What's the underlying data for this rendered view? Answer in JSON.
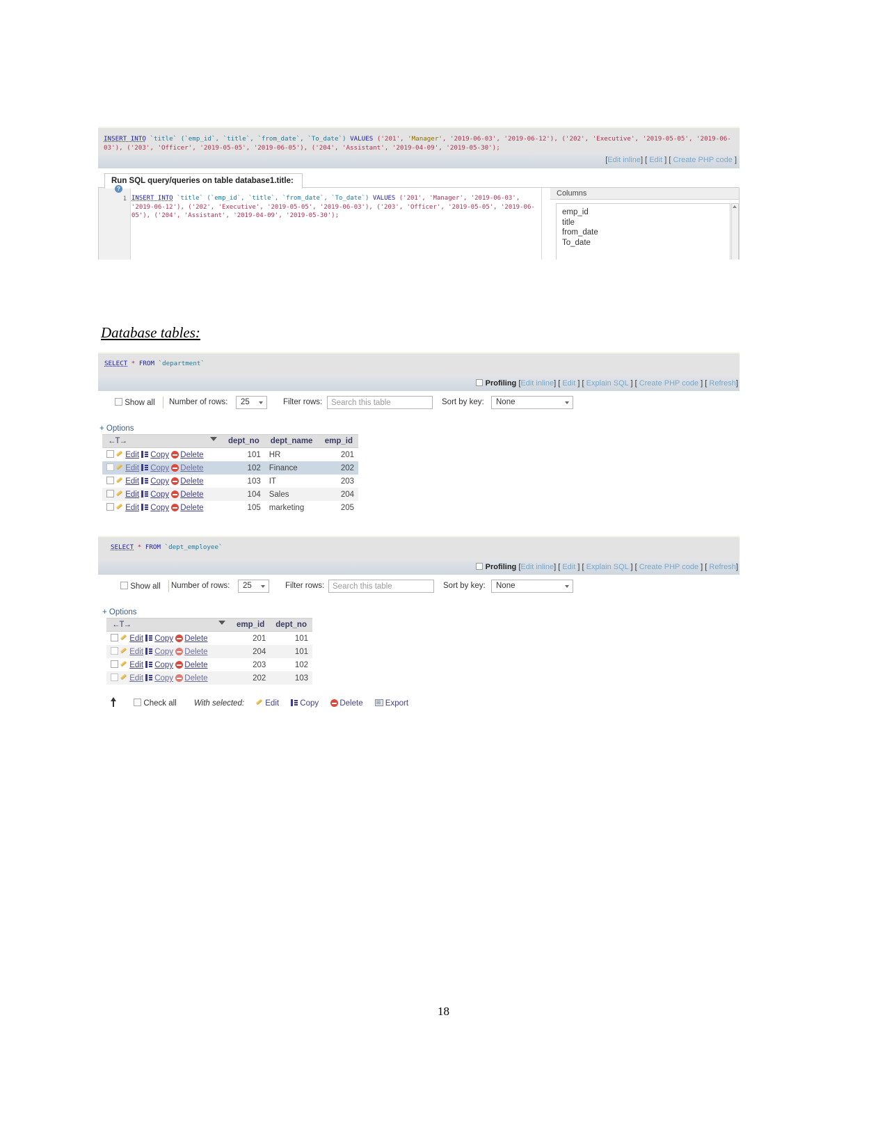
{
  "document": {
    "page_number": "18",
    "section_heading": "Database tables:"
  },
  "sql_echo": {
    "query_parts": {
      "kw_insert": "INSERT INTO",
      "table": "`title`",
      "cols": "(`emp_id`, `title`, `from_date`, `To_date`)",
      "kw_values": "VALUES",
      "tuples": "('201', 'Manager', '2019-06-03', '2019-06-12'), ('202', 'Executive', '2019-05-05', '2019-06-03'), ('203', 'Officer', '2019-05-05', '2019-06-05'), ('204', 'Assistant', '2019-04-09', '2019-05-30');"
    },
    "full_query": "INSERT INTO `title` (`emp_id`, `title`, `from_date`, `To_date`) VALUES ('201', 'Manager', '2019-06-03', '2019-06-12'), ('202', 'Executive', '2019-05-05', '2019-06-03'), ('203', 'Officer', '2019-05-05', '2019-06-05'), ('204', 'Assistant', '2019-04-09', '2019-05-30');",
    "actions": {
      "open_bracket": "[",
      "edit_inline": "Edit inline",
      "close_open": "] [",
      "edit": "Edit",
      "sep2": "] [",
      "create_php": "Create PHP code",
      "close_bracket": "]"
    }
  },
  "run_sql_panel": {
    "title": "Run SQL query/queries on table database1.title:",
    "help_glyph": "?",
    "line_number": "1",
    "editor_query": "INSERT INTO `title` (`emp_id`, `title`, `from_date`, `To_date`) VALUES ('201', 'Manager', '2019-06-03', '2019-06-12'), ('202', 'Executive', '2019-05-05', '2019-06-03'), ('203', 'Officer', '2019-05-05', '2019-06-05'), ('204', 'Assistant', '2019-04-09', '2019-05-30');",
    "columns_label": "Columns",
    "columns": [
      "emp_id",
      "title",
      "from_date",
      "To_date"
    ]
  },
  "result_department": {
    "query_kw": "SELECT",
    "query_star": "*",
    "query_from": "FROM",
    "query_table": "`department`",
    "query_full": "SELECT * FROM `department`",
    "actions": {
      "profiling": "Profiling",
      "edit_inline": "Edit inline",
      "edit": "Edit",
      "explain_sql": "Explain SQL",
      "create_php": "Create PHP code",
      "refresh": "Refresh"
    },
    "controls": {
      "show_all": "Show all",
      "number_of_rows_label": "Number of rows:",
      "number_of_rows_value": "25",
      "filter_rows_label": "Filter rows:",
      "filter_rows_placeholder": "Search this table",
      "sort_by_key_label": "Sort by key:",
      "sort_by_key_value": "None"
    },
    "options_label": "Options",
    "options_marker": "+",
    "row_actions": {
      "edit": "Edit",
      "copy": "Copy",
      "delete": "Delete"
    },
    "columns": [
      "dept_no",
      "dept_name",
      "emp_id"
    ],
    "rows": [
      {
        "dept_no": "101",
        "dept_name": "HR",
        "emp_id": "201"
      },
      {
        "dept_no": "102",
        "dept_name": "Finance",
        "emp_id": "202"
      },
      {
        "dept_no": "103",
        "dept_name": "IT",
        "emp_id": "203"
      },
      {
        "dept_no": "104",
        "dept_name": "Sales",
        "emp_id": "204"
      },
      {
        "dept_no": "105",
        "dept_name": "marketing",
        "emp_id": "205"
      }
    ]
  },
  "result_dept_employee": {
    "query_kw": "SELECT",
    "query_star": "*",
    "query_from": "FROM",
    "query_table": "`dept_employee`",
    "query_full": "SELECT * FROM `dept_employee`",
    "actions": {
      "profiling": "Profiling",
      "edit_inline": "Edit inline",
      "edit": "Edit",
      "explain_sql": "Explain SQL",
      "create_php": "Create PHP code",
      "refresh": "Refresh"
    },
    "controls": {
      "show_all": "Show all",
      "number_of_rows_label": "Number of rows:",
      "number_of_rows_value": "25",
      "filter_rows_label": "Filter rows:",
      "filter_rows_placeholder": "Search this table",
      "sort_by_key_label": "Sort by key:",
      "sort_by_key_value": "None"
    },
    "options_label": "Options",
    "options_marker": "+",
    "row_actions": {
      "edit": "Edit",
      "copy": "Copy",
      "delete": "Delete"
    },
    "columns": [
      "emp_id",
      "dept_no"
    ],
    "rows": [
      {
        "emp_id": "201",
        "dept_no": "101"
      },
      {
        "emp_id": "204",
        "dept_no": "101"
      },
      {
        "emp_id": "203",
        "dept_no": "102"
      },
      {
        "emp_id": "202",
        "dept_no": "103"
      }
    ],
    "footer": {
      "check_all": "Check all",
      "with_selected": "With selected:",
      "edit": "Edit",
      "copy": "Copy",
      "delete": "Delete",
      "export": "Export"
    }
  }
}
